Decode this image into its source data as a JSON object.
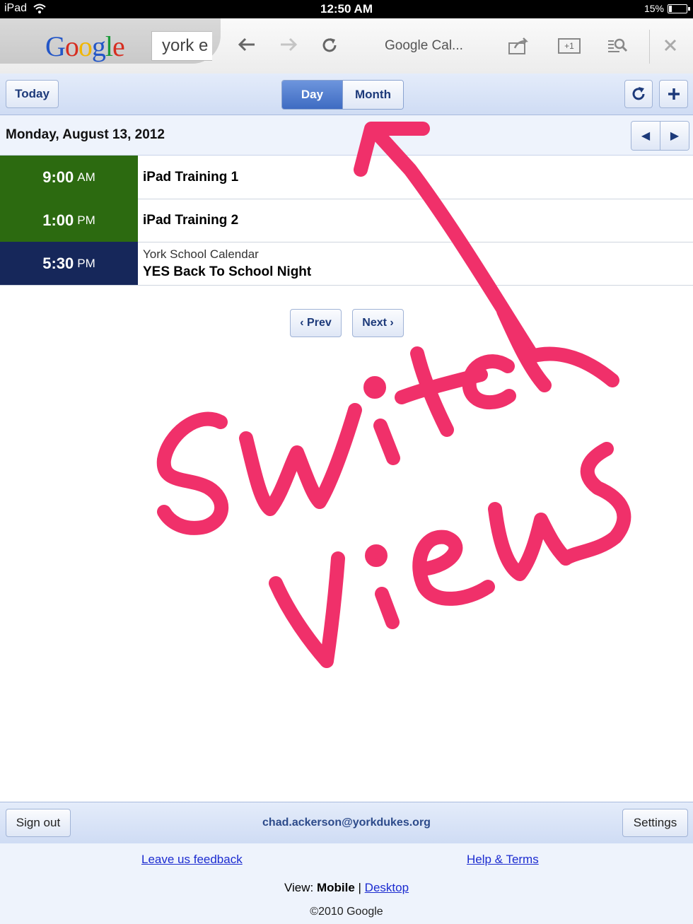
{
  "status": {
    "device": "iPad",
    "time": "12:50 AM",
    "battery": "15%",
    "battery_level": 0.15
  },
  "browser": {
    "logo": "Google",
    "search_text": "york e",
    "page_title": "Google Cal...",
    "plus_one": "+1"
  },
  "calendar": {
    "today_label": "Today",
    "view_tabs": [
      {
        "label": "Day",
        "active": true
      },
      {
        "label": "Month",
        "active": false
      }
    ],
    "date": "Monday, August 13, 2012",
    "events": [
      {
        "time": "9:00",
        "ampm": "AM",
        "title": "iPad Training 1",
        "calendar": "",
        "color": "#2c6a10"
      },
      {
        "time": "1:00",
        "ampm": "PM",
        "title": "iPad Training 2",
        "calendar": "",
        "color": "#2c6a10"
      },
      {
        "time": "5:30",
        "ampm": "PM",
        "title": "YES Back To School Night",
        "calendar": "York School Calendar",
        "color": "#16275a"
      }
    ],
    "prev_label": "‹ Prev",
    "next_label": "Next ›"
  },
  "footer": {
    "sign_out": "Sign out",
    "email": "chad.ackerson@yorkdukes.org",
    "settings": "Settings",
    "feedback": "Leave us feedback",
    "help": "Help & Terms",
    "view_prefix": "View:",
    "view_mobile": "Mobile",
    "view_sep": "|",
    "view_desktop": "Desktop",
    "copyright": "©2010 Google"
  },
  "annotation": {
    "text": "Switch Views",
    "color": "#f0306a"
  }
}
